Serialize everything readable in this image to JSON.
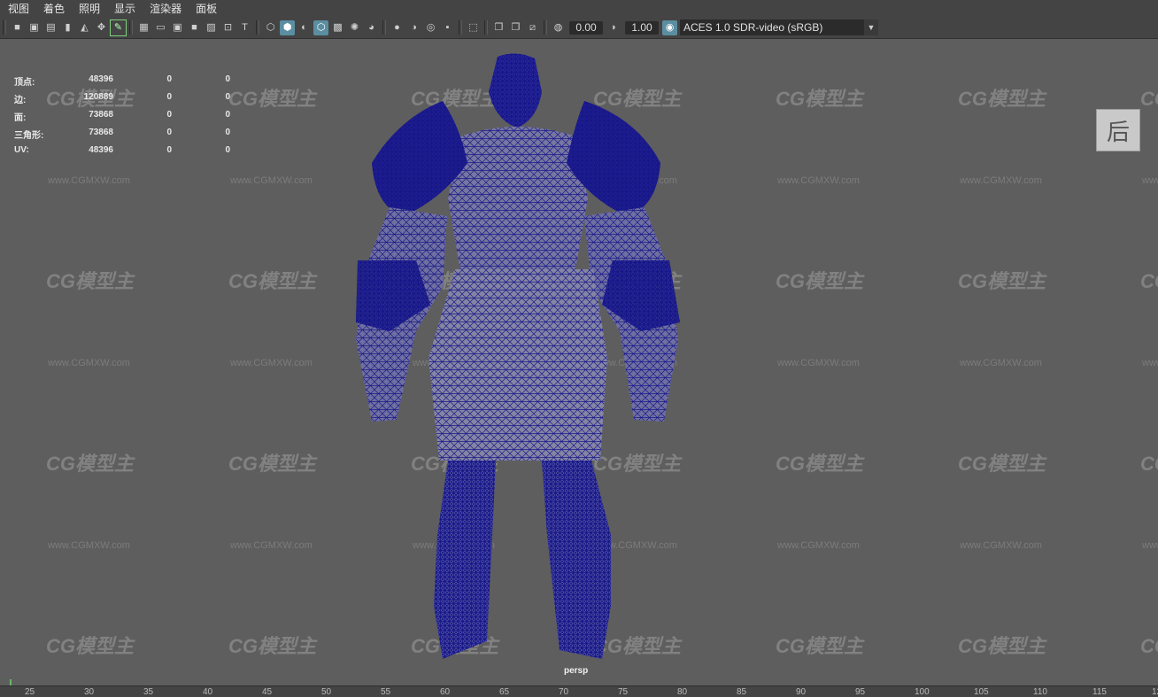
{
  "menu": [
    "视图",
    "着色",
    "照明",
    "显示",
    "渲染器",
    "面板"
  ],
  "toolbar": {
    "exposure": "0.00",
    "gamma": "1.00",
    "colorspace": "ACES 1.0 SDR-video (sRGB)"
  },
  "hud": {
    "rows": [
      {
        "label": "顶点:",
        "a": "48396",
        "b": "0",
        "c": "0"
      },
      {
        "label": "边:",
        "a": "120889",
        "b": "0",
        "c": "0"
      },
      {
        "label": "面:",
        "a": "73868",
        "b": "0",
        "c": "0"
      },
      {
        "label": "三角形:",
        "a": "73868",
        "b": "0",
        "c": "0"
      },
      {
        "label": "UV:",
        "a": "48396",
        "b": "0",
        "c": "0"
      }
    ]
  },
  "viewcube_label": "后",
  "camera": "persp",
  "watermark": {
    "logo": "CG模型主",
    "url": "www.CGMXW.com"
  },
  "timeline_ticks": [
    "25",
    "30",
    "35",
    "40",
    "45",
    "50",
    "55",
    "60",
    "65",
    "70",
    "75",
    "80",
    "85",
    "90",
    "95",
    "100",
    "105",
    "110",
    "115",
    "12"
  ]
}
